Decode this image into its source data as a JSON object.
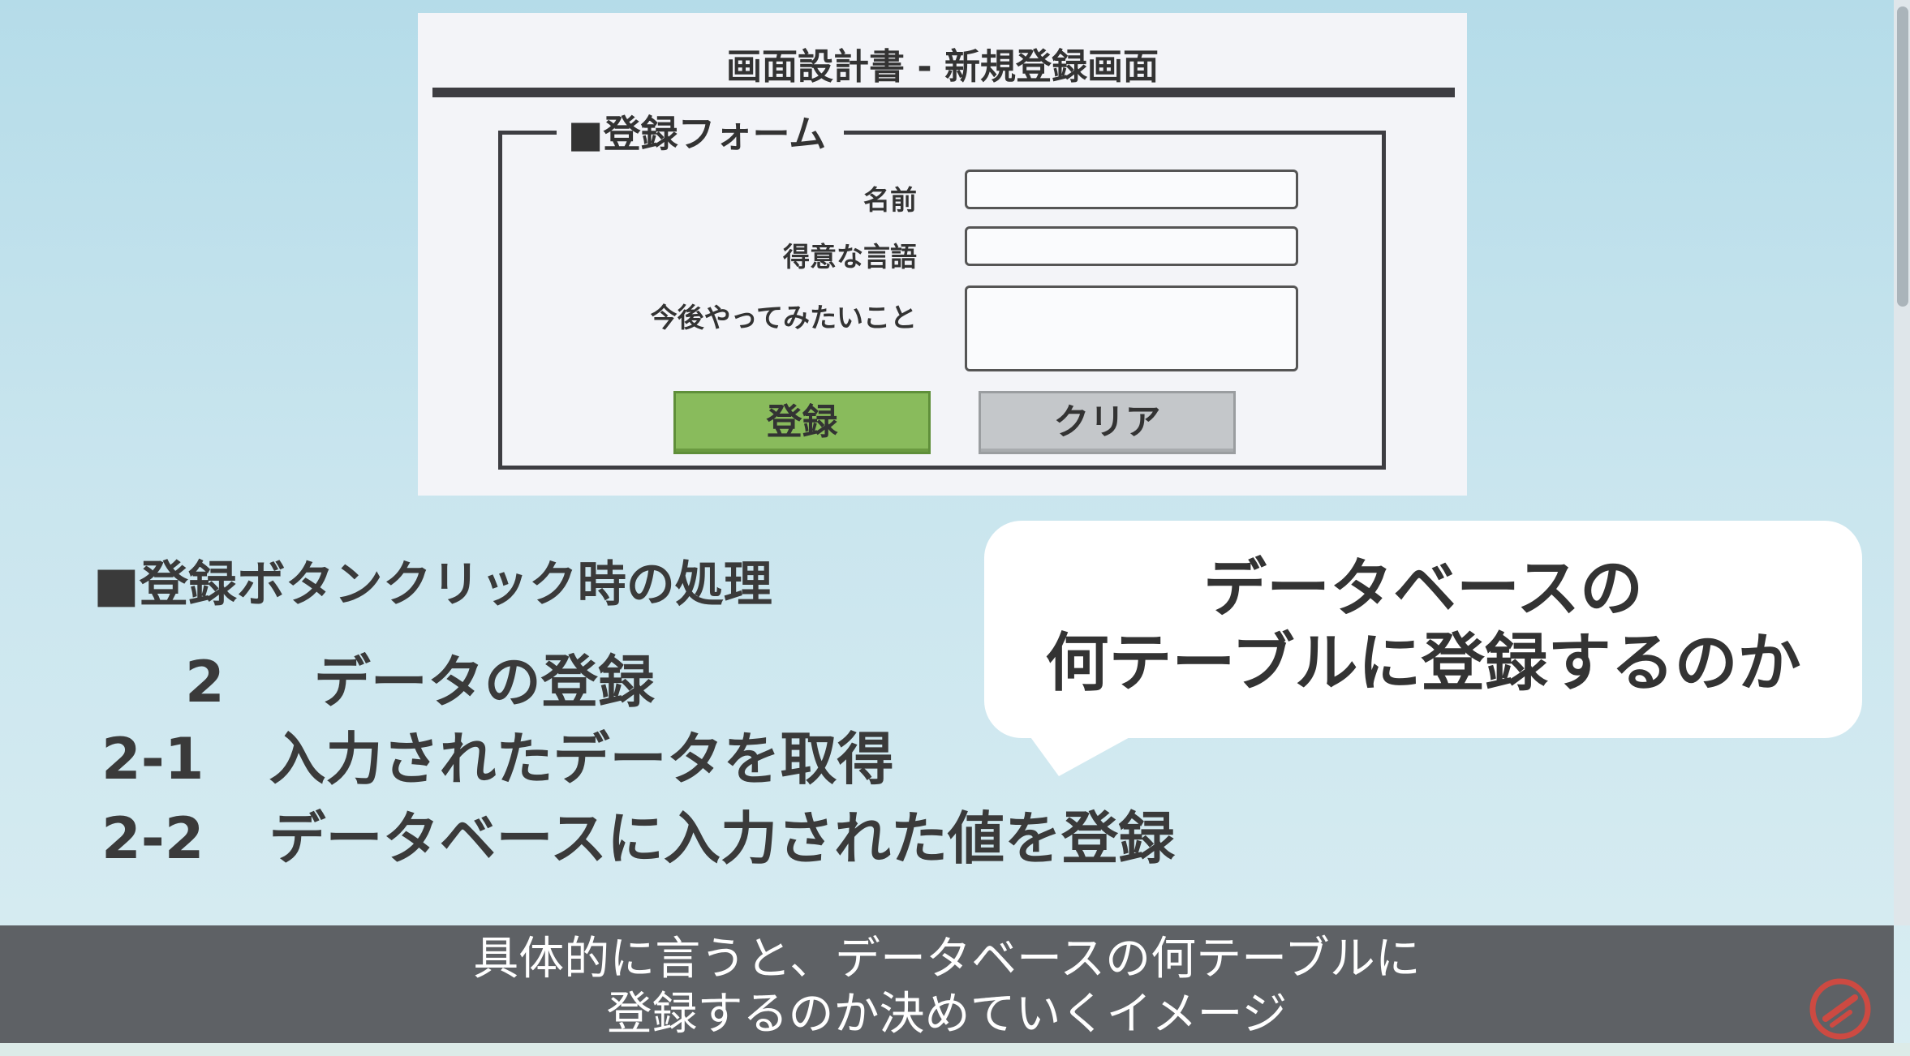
{
  "design_doc": {
    "title": "画面設計書 - 新規登録画面",
    "form_legend": "■登録フォーム",
    "fields": [
      {
        "label": "名前",
        "value": ""
      },
      {
        "label": "得意な言語",
        "value": ""
      },
      {
        "label": "今後やってみたいこと",
        "value": ""
      }
    ],
    "buttons": {
      "register": "登録",
      "clear": "クリア"
    }
  },
  "process": {
    "heading": "■登録ボタンクリック時の処理",
    "steps": [
      {
        "num": "2",
        "text": "データの登録"
      },
      {
        "num": "2-1",
        "text": "入力されたデータを取得"
      },
      {
        "num": "2-2",
        "text": "データベースに入力された値を登録"
      }
    ]
  },
  "bubble": {
    "line1": "データベースの",
    "line2": "何テーブルに登録するのか"
  },
  "subtitle": {
    "line1": "具体的に言うと、データベースの何テーブルに",
    "line2": "登録するのか決めていくイメージ"
  },
  "colors": {
    "register_button": "#89bb5c",
    "clear_button": "#c4c7ca",
    "subtitle_bar": "#5e6165",
    "logo": "#e0463c"
  },
  "icons": {
    "logo": "red-circle-logo-icon"
  }
}
